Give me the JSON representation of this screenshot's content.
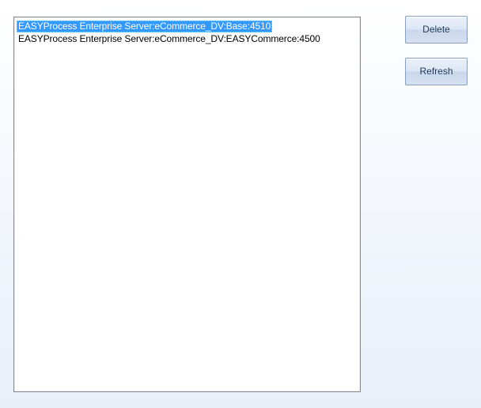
{
  "services_list": {
    "items": [
      {
        "label": "EASYProcess Enterprise Server:eCommerce_DV:Base:4510",
        "selected": true
      },
      {
        "label": "EASYProcess Enterprise Server:eCommerce_DV:EASYCommerce:4500",
        "selected": false
      }
    ]
  },
  "actions": {
    "delete_label": "Delete",
    "refresh_label": "Refresh"
  },
  "colors": {
    "selection": "#3399ff",
    "button_text": "#1e395b",
    "list_border": "#828790"
  }
}
